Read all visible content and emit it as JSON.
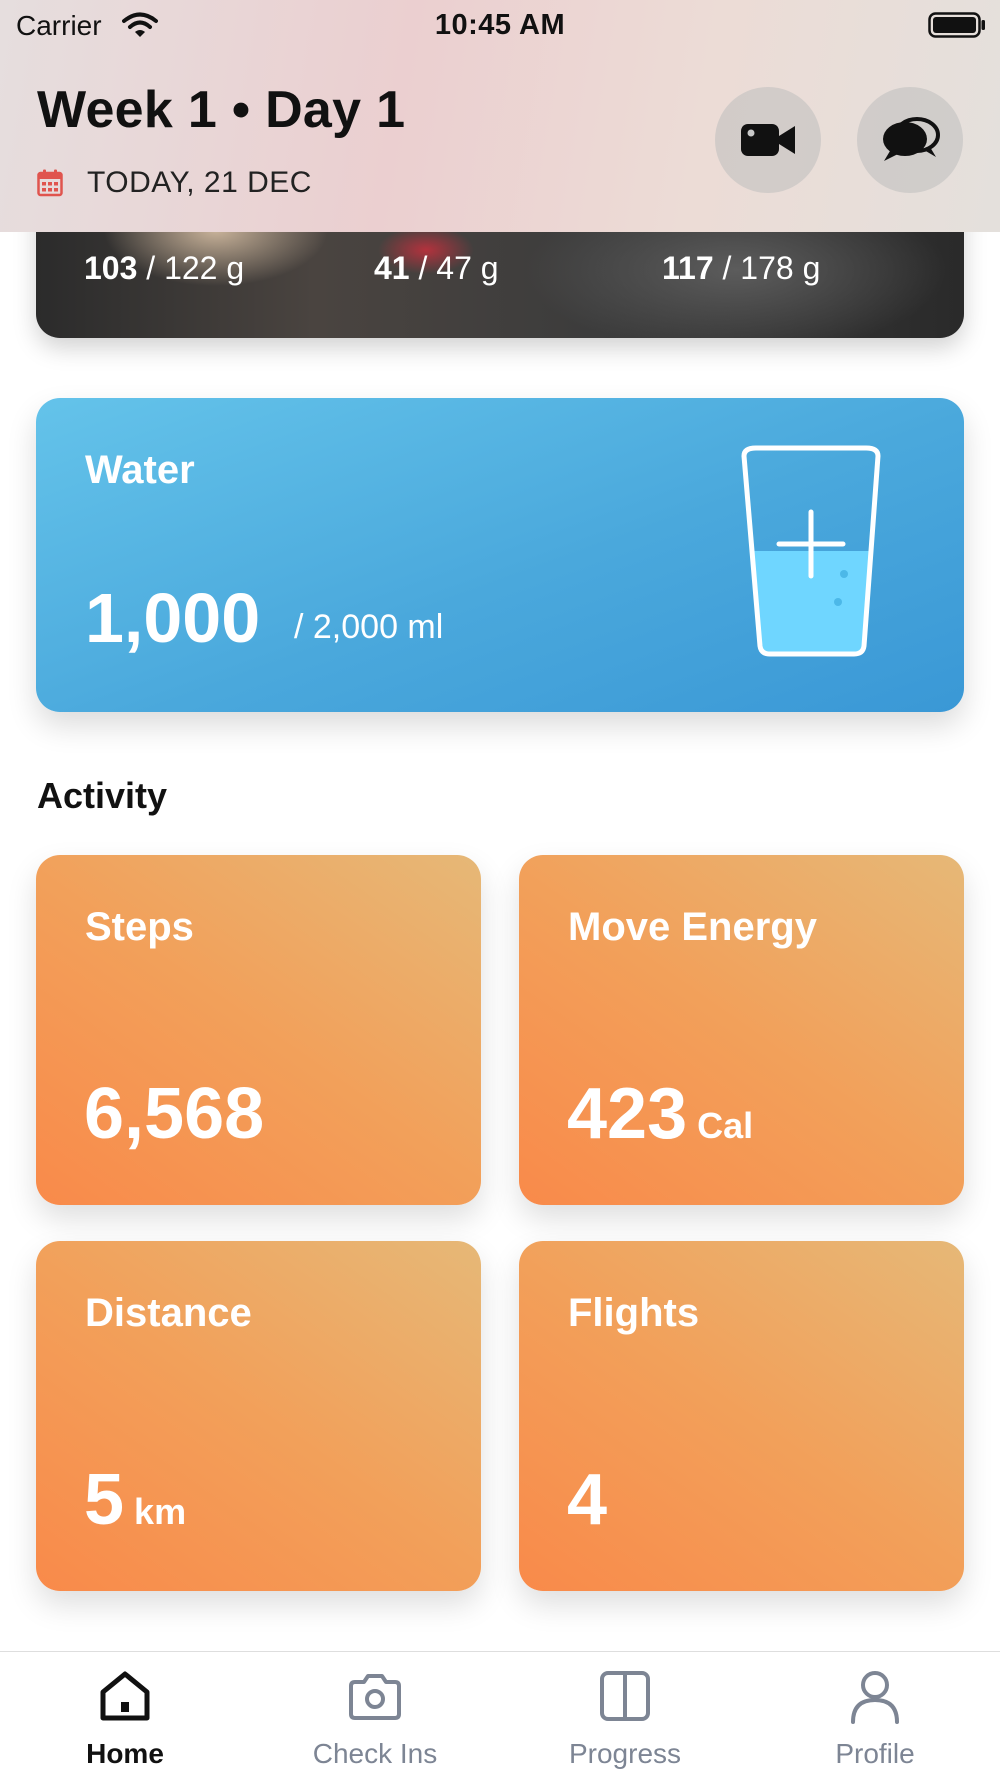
{
  "status_bar": {
    "carrier": "Carrier",
    "time": "10:45 AM",
    "icons": [
      "wifi-icon",
      "battery-icon"
    ]
  },
  "header": {
    "title": "Week 1 • Day 1",
    "date_label": "TODAY, 21 DEC",
    "date_icon": "calendar-icon",
    "actions": [
      {
        "name": "video-call",
        "icon": "video-camera-icon"
      },
      {
        "name": "chat",
        "icon": "chat-bubbles-icon"
      }
    ]
  },
  "meal_card": {
    "macros": [
      {
        "current": "103",
        "target": "122 g"
      },
      {
        "current": "41",
        "target": "47 g"
      },
      {
        "current": "117",
        "target": "178 g"
      }
    ]
  },
  "water": {
    "title": "Water",
    "value": "1,000",
    "goal": "/  2,000 ml",
    "fill_fraction": 0.5,
    "icon": "water-glass-plus-icon",
    "color_top": "#64c3ea",
    "color_bottom": "#3a98d6"
  },
  "activity": {
    "title": "Activity",
    "tiles": [
      {
        "label": "Steps",
        "value": "6,568",
        "unit": ""
      },
      {
        "label": "Move Energy",
        "value": "423",
        "unit": "Cal"
      },
      {
        "label": "Distance",
        "value": "5",
        "unit": "km"
      },
      {
        "label": "Flights",
        "value": "4",
        "unit": ""
      }
    ],
    "tile_gradient": [
      "#f98a4a",
      "#e6b877"
    ]
  },
  "tab_bar": {
    "active": "Home",
    "tabs": [
      {
        "label": "Home",
        "icon": "home-icon"
      },
      {
        "label": "Check Ins",
        "icon": "camera-icon"
      },
      {
        "label": "Progress",
        "icon": "split-panel-icon"
      },
      {
        "label": "Profile",
        "icon": "person-icon"
      }
    ]
  }
}
